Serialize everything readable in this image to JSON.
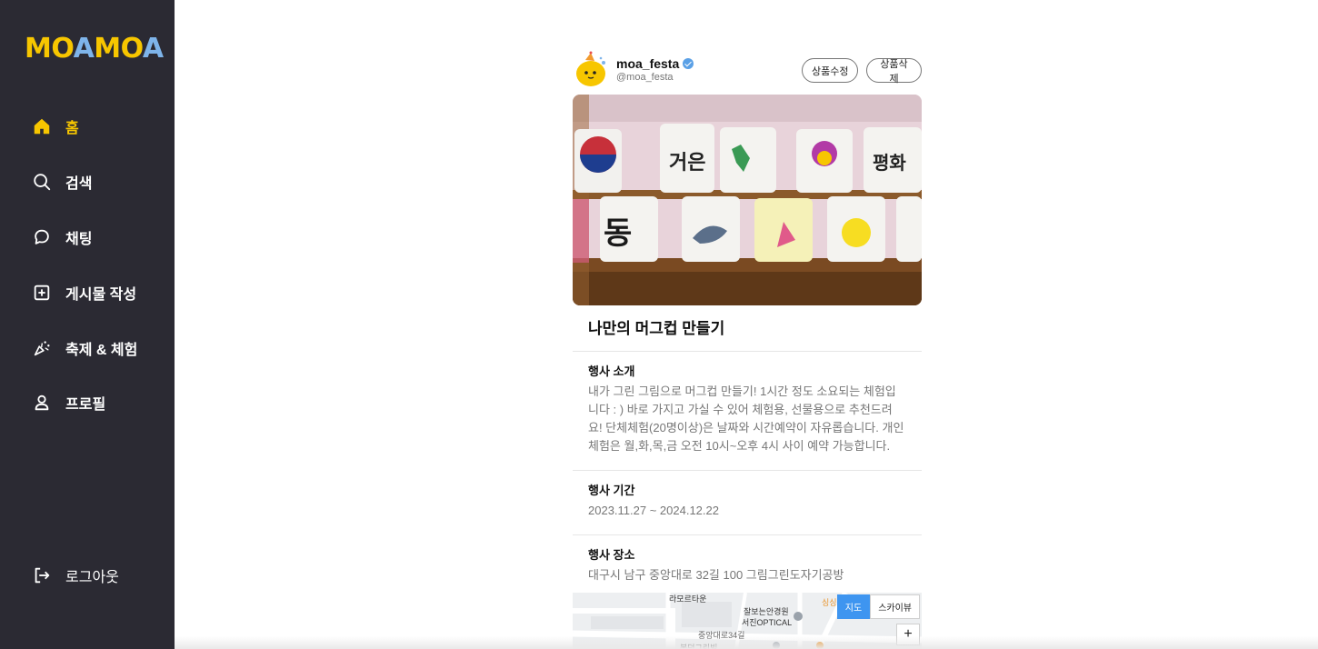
{
  "brand": {
    "logo_part1": "MO",
    "logo_part2": "A",
    "logo_part3": "MO",
    "logo_part4": "A",
    "logo_primary": "#f7c600",
    "logo_accent": "#7eb4ea"
  },
  "sidebar": {
    "items": [
      {
        "label": "홈",
        "icon": "home-icon",
        "active": true
      },
      {
        "label": "검색",
        "icon": "search-icon",
        "active": false
      },
      {
        "label": "채팅",
        "icon": "chat-icon",
        "active": false
      },
      {
        "label": "게시물 작성",
        "icon": "plus-square-icon",
        "active": false
      },
      {
        "label": "축제 & 체험",
        "icon": "festival-icon",
        "active": false
      },
      {
        "label": "프로필",
        "icon": "user-icon",
        "active": false
      }
    ],
    "logout_label": "로그아웃"
  },
  "post": {
    "username": "moa_festa",
    "handle": "@moa_festa",
    "edit_label": "상품수정",
    "delete_label": "상품삭제",
    "title": "나만의 머그컵 만들기",
    "sections": [
      {
        "heading": "행사 소개",
        "body": "내가 그린 그림으로 머그컵 만들기! 1시간 정도 소요되는 체험입니다 : ) 바로 가지고 가실 수 있어 체험용, 선물용으로 추천드려요! 단체체험(20명이상)은 날짜와 시간예약이 자유롭습니다. 개인체험은 월,화,목,금 오전 10시~오후 4시 사이 예약 가능합니다."
      },
      {
        "heading": "행사 기간",
        "body": "2023.11.27 ~ 2024.12.22"
      },
      {
        "heading": "행사 장소",
        "body": "대구시 남구 중앙대로 32길 100 그림그린도자기공방"
      }
    ]
  },
  "map": {
    "map_label": "지도",
    "skyview_label": "스카이뷰",
    "zoom_in": "+",
    "place_labels": [
      "라모르타운",
      "잘보는안경원",
      "서진OPTICAL",
      "중앙대로34길",
      "봉덕그린빌",
      "싱싱"
    ]
  },
  "colors": {
    "sidebar_bg": "#2b2a33",
    "active": "#f7c600",
    "map_button_active": "#3e95f0"
  }
}
